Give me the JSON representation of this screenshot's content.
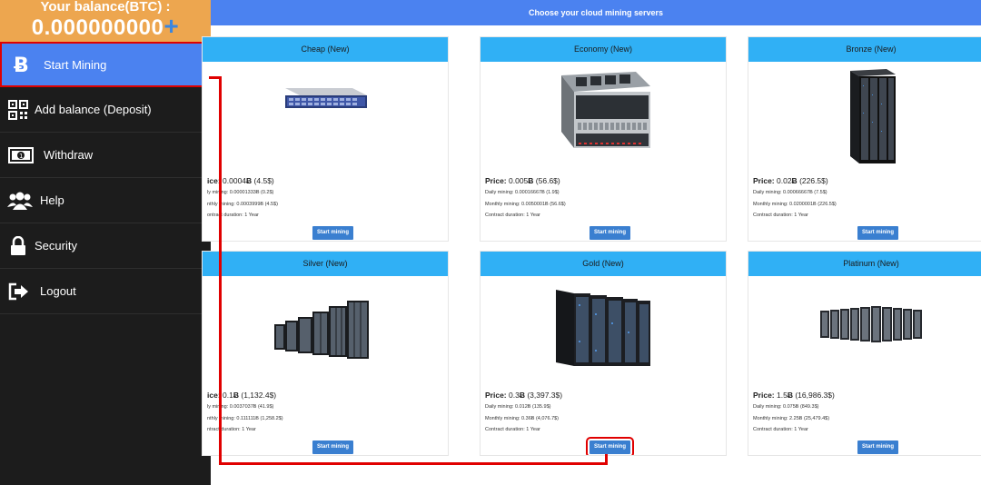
{
  "balance": {
    "title": "Your balance(BTC) :",
    "value": "0.000000000",
    "plus": "+"
  },
  "nav": [
    {
      "label": "Start Mining",
      "icon": "bitcoin-icon"
    },
    {
      "label": "Add balance (Deposit)",
      "icon": "qr-code-icon"
    },
    {
      "label": "Withdraw",
      "icon": "banknote-icon"
    },
    {
      "label": "Help",
      "icon": "users-icon"
    },
    {
      "label": "Security",
      "icon": "lock-icon"
    },
    {
      "label": "Logout",
      "icon": "logout-icon"
    }
  ],
  "header": {
    "title": "Choose your cloud mining servers"
  },
  "cards": [
    {
      "name": "Cheap (New)",
      "price_label": "ice:",
      "price_btc": "0.0004",
      "price_usd": "(4.5$)",
      "daily": "ly mining: 0.00001333Ƀ (0.2$)",
      "monthly": "nthly mining: 0.0003999Ƀ (4.5$)",
      "contract": "ontract duration: 1 Year",
      "button": "Start mining"
    },
    {
      "name": "Economy (New)",
      "price_label": "Price:",
      "price_btc": "0.005",
      "price_usd": "(56.6$)",
      "daily": "Daily mining: 0.00016667Ƀ (1.9$)",
      "monthly": "Monthly mining: 0.0050001Ƀ (56.6$)",
      "contract": "Contract duration: 1 Year",
      "button": "Start mining"
    },
    {
      "name": "Bronze (New)",
      "price_label": "Price:",
      "price_btc": "0.02",
      "price_usd": "(226.5$)",
      "daily": "Daily mining: 0.00066667Ƀ (7.5$)",
      "monthly": "Monthly mining: 0.0200001Ƀ (226.5$)",
      "contract": "Contract duration: 1 Year",
      "button": "Start mining"
    },
    {
      "name": "Silver (New)",
      "price_label": "ice:",
      "price_btc": "0.1",
      "price_usd": "(1,132.4$)",
      "daily": "ly mining: 0.0037037Ƀ (41.9$)",
      "monthly": "nthly mining: 0.111111Ƀ (1,258.2$)",
      "contract": "ntract duration: 1 Year",
      "button": "Start mining"
    },
    {
      "name": "Gold (New)",
      "price_label": "Price:",
      "price_btc": "0.3",
      "price_usd": "(3,397.3$)",
      "daily": "Daily mining: 0.012Ƀ (135.9$)",
      "monthly": "Monthly mining: 0.36Ƀ (4,076.7$)",
      "contract": "Contract duration: 1 Year",
      "button": "Start mining"
    },
    {
      "name": "Platinum (New)",
      "price_label": "Price:",
      "price_btc": "1.5",
      "price_usd": "(16,986.3$)",
      "daily": "Daily mining: 0.075Ƀ (849.3$)",
      "monthly": "Monthly mining: 2.25Ƀ (25,479.4$)",
      "contract": "Contract duration: 1 Year",
      "button": "Start mining"
    }
  ],
  "btc_symbol": "Ƀ",
  "colors": {
    "accent": "#4b82f0",
    "card_header": "#30b0f5",
    "balance_bg": "#eda64f",
    "highlight": "#e00000"
  }
}
